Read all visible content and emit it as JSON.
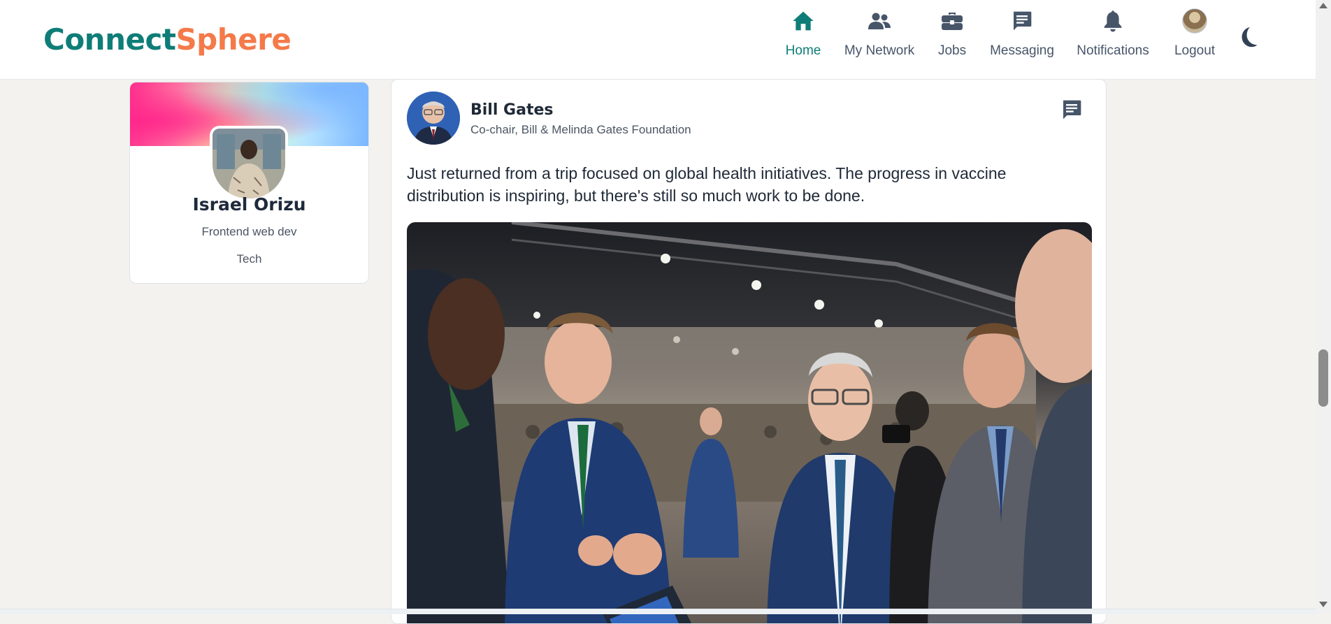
{
  "brand": {
    "part1": "Connect",
    "part2": "Sphere",
    "color1": "#0f7d77",
    "color2": "#f47a4a"
  },
  "nav": {
    "items": [
      {
        "label": "Home",
        "icon": "home-icon",
        "active": true
      },
      {
        "label": "My Network",
        "icon": "people-icon",
        "active": false
      },
      {
        "label": "Jobs",
        "icon": "briefcase-icon",
        "active": false
      },
      {
        "label": "Messaging",
        "icon": "message-icon",
        "active": false
      },
      {
        "label": "Notifications",
        "icon": "bell-icon",
        "active": false
      },
      {
        "label": "Logout",
        "icon": "user-avatar",
        "active": false
      }
    ],
    "theme_toggle_icon": "moon-icon"
  },
  "profile": {
    "name": "Israel Orizu",
    "role": "Frontend web dev",
    "industry": "Tech"
  },
  "post": {
    "author": "Bill Gates",
    "headline": "Co-chair, Bill & Melinda Gates Foundation",
    "text": "Just returned from a trip focused on global health initiatives. The progress in vaccine distribution is inspiring, but there's still so much work to be done.",
    "message_icon": "message-icon"
  },
  "colors": {
    "accent": "#0f7d77",
    "icon_gray": "#475569"
  }
}
